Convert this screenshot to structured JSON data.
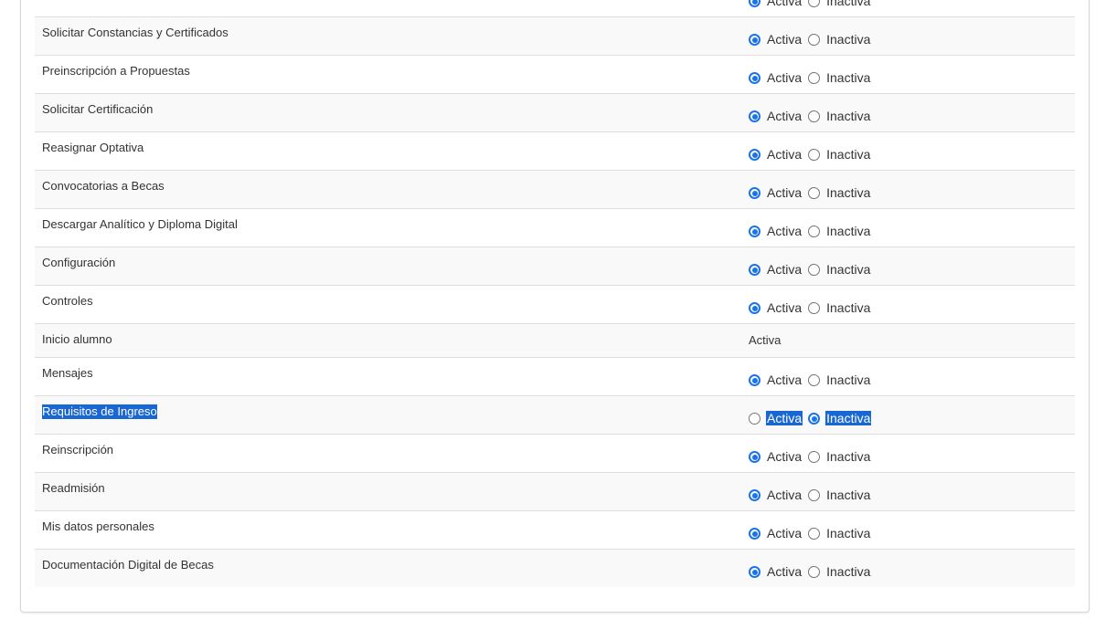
{
  "rows": [
    {
      "name": "",
      "mode": "radio",
      "selected": "activa",
      "highlight": false
    },
    {
      "name": "Solicitar Constancias y Certificados",
      "mode": "radio",
      "selected": "activa",
      "highlight": false
    },
    {
      "name": "Preinscripción a Propuestas",
      "mode": "radio",
      "selected": "activa",
      "highlight": false
    },
    {
      "name": "Solicitar Certificación",
      "mode": "radio",
      "selected": "activa",
      "highlight": false
    },
    {
      "name": "Reasignar Optativa",
      "mode": "radio",
      "selected": "activa",
      "highlight": false
    },
    {
      "name": "Convocatorias a Becas",
      "mode": "radio",
      "selected": "activa",
      "highlight": false
    },
    {
      "name": "Descargar Analítico y Diploma Digital",
      "mode": "radio",
      "selected": "activa",
      "highlight": false
    },
    {
      "name": "Configuración",
      "mode": "radio",
      "selected": "activa",
      "highlight": false
    },
    {
      "name": "Controles",
      "mode": "radio",
      "selected": "activa",
      "highlight": false
    },
    {
      "name": "Inicio alumno",
      "mode": "static",
      "value": "Activa",
      "highlight": false
    },
    {
      "name": "Mensajes",
      "mode": "radio",
      "selected": "activa",
      "highlight": false
    },
    {
      "name": "Requisitos de Ingreso",
      "mode": "radio",
      "selected": "inactiva",
      "highlight": true
    },
    {
      "name": "Reinscripción",
      "mode": "radio",
      "selected": "activa",
      "highlight": false
    },
    {
      "name": "Readmisión",
      "mode": "radio",
      "selected": "activa",
      "highlight": false
    },
    {
      "name": "Mis datos personales",
      "mode": "radio",
      "selected": "activa",
      "highlight": false
    },
    {
      "name": "Documentación Digital de Becas",
      "mode": "radio",
      "selected": "activa",
      "highlight": false
    }
  ],
  "labels": {
    "activa": "Activa",
    "inactiva": "Inactiva"
  },
  "colors": {
    "radio_accent": "#1a73e8",
    "selection_bg": "#1967d2",
    "row_stripe": "#f9f9f9",
    "row_border": "#dddddd"
  }
}
